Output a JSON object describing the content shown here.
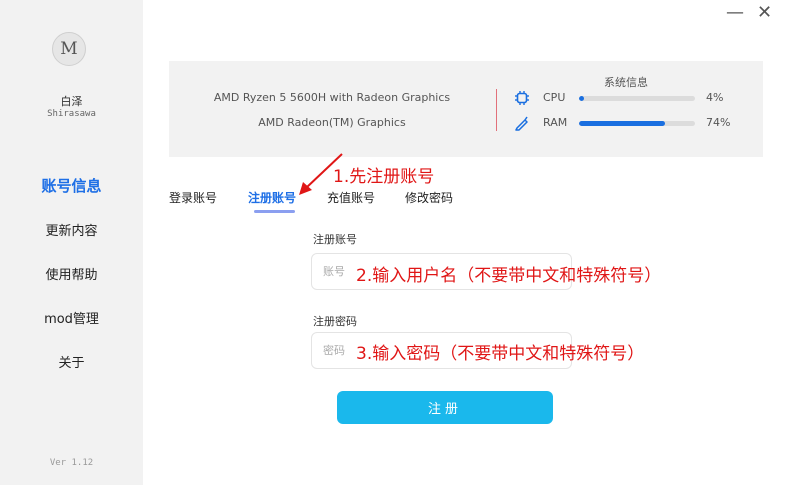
{
  "window": {
    "minimize_label": "—",
    "close_label": "✕"
  },
  "sidebar": {
    "logo_text": "M",
    "user_name": "白泽",
    "user_sub": "Shirasawa",
    "items": [
      {
        "label": "账号信息",
        "active": true
      },
      {
        "label": "更新内容",
        "active": false
      },
      {
        "label": "使用帮助",
        "active": false
      },
      {
        "label": "mod管理",
        "active": false
      },
      {
        "label": "关于",
        "active": false
      }
    ],
    "version": "Ver 1.12"
  },
  "system": {
    "title": "系统信息",
    "cpu_name": "AMD Ryzen 5 5600H with Radeon Graphics",
    "gpu_name": "AMD Radeon(TM) Graphics",
    "metrics": [
      {
        "label": "CPU",
        "percent_text": "4%",
        "value": 4,
        "icon": "chip-icon"
      },
      {
        "label": "RAM",
        "percent_text": "74%",
        "value": 74,
        "icon": "memory-icon"
      }
    ],
    "accent_color": "#1a6fe0"
  },
  "tabs": [
    {
      "label": "登录账号",
      "active": false
    },
    {
      "label": "注册账号",
      "active": true
    },
    {
      "label": "充值账号",
      "active": false
    },
    {
      "label": "修改密码",
      "active": false
    }
  ],
  "form": {
    "account_label": "注册账号",
    "account_placeholder": "账号",
    "password_label": "注册密码",
    "password_placeholder": "密码",
    "submit_label": "注册",
    "submit_color": "#1ab8ec"
  },
  "annotations": {
    "step1": "1.先注册账号",
    "step2": "2.输入用户名（不要带中文和特殊符号）",
    "step3": "3.输入密码（不要带中文和特殊符号）",
    "color": "#e01616"
  }
}
